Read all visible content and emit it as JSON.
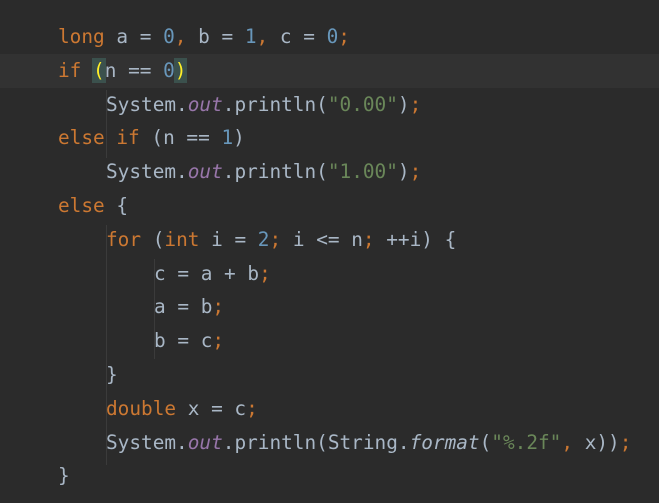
{
  "editor": {
    "colors": {
      "background": "#2b2b2b",
      "current_line": "#323232",
      "keyword": "#cc7832",
      "number": "#6897bb",
      "string": "#6a8759",
      "field": "#9876aa",
      "default": "#a9b7c6",
      "brace_match": "#ffef28"
    },
    "lines": [
      {
        "tokens": [
          {
            "t": "long",
            "c": "kw"
          },
          {
            "t": " a = ",
            "c": "plain"
          },
          {
            "t": "0",
            "c": "num"
          },
          {
            "t": ", ",
            "c": "punc"
          },
          {
            "t": "b = ",
            "c": "plain"
          },
          {
            "t": "1",
            "c": "num"
          },
          {
            "t": ", ",
            "c": "punc"
          },
          {
            "t": "c = ",
            "c": "plain"
          },
          {
            "t": "0",
            "c": "num"
          },
          {
            "t": ";",
            "c": "punc"
          }
        ]
      },
      {
        "current": true,
        "tokens": [
          {
            "t": "if",
            "c": "kw"
          },
          {
            "t": " ",
            "c": "plain"
          },
          {
            "t": "(",
            "c": "brace-match"
          },
          {
            "t": "n == ",
            "c": "plain"
          },
          {
            "t": "0",
            "c": "num"
          },
          {
            "t": ")",
            "c": "brace-match"
          }
        ]
      },
      {
        "indent": 1,
        "tokens": [
          {
            "t": "System.",
            "c": "plain"
          },
          {
            "t": "out",
            "c": "fld"
          },
          {
            "t": ".println(",
            "c": "plain"
          },
          {
            "t": "\"0.00\"",
            "c": "str"
          },
          {
            "t": ")",
            "c": "plain"
          },
          {
            "t": ";",
            "c": "punc"
          }
        ]
      },
      {
        "tokens": [
          {
            "t": "else if",
            "c": "kw"
          },
          {
            "t": " (n == ",
            "c": "plain"
          },
          {
            "t": "1",
            "c": "num"
          },
          {
            "t": ")",
            "c": "plain"
          }
        ]
      },
      {
        "indent": 1,
        "tokens": [
          {
            "t": "System.",
            "c": "plain"
          },
          {
            "t": "out",
            "c": "fld"
          },
          {
            "t": ".println(",
            "c": "plain"
          },
          {
            "t": "\"1.00\"",
            "c": "str"
          },
          {
            "t": ")",
            "c": "plain"
          },
          {
            "t": ";",
            "c": "punc"
          }
        ]
      },
      {
        "tokens": [
          {
            "t": "else",
            "c": "kw"
          },
          {
            "t": " {",
            "c": "plain"
          }
        ]
      },
      {
        "indent": 1,
        "tokens": [
          {
            "t": "for",
            "c": "kw"
          },
          {
            "t": " (",
            "c": "plain"
          },
          {
            "t": "int",
            "c": "kw"
          },
          {
            "t": " i = ",
            "c": "plain"
          },
          {
            "t": "2",
            "c": "num"
          },
          {
            "t": "; ",
            "c": "punc"
          },
          {
            "t": "i <= n",
            "c": "plain"
          },
          {
            "t": "; ",
            "c": "punc"
          },
          {
            "t": "++i) {",
            "c": "plain"
          }
        ]
      },
      {
        "indent": 2,
        "tokens": [
          {
            "t": "c = a + b",
            "c": "plain"
          },
          {
            "t": ";",
            "c": "punc"
          }
        ]
      },
      {
        "indent": 2,
        "tokens": [
          {
            "t": "a = b",
            "c": "plain"
          },
          {
            "t": ";",
            "c": "punc"
          }
        ]
      },
      {
        "indent": 2,
        "tokens": [
          {
            "t": "b = c",
            "c": "plain"
          },
          {
            "t": ";",
            "c": "punc"
          }
        ]
      },
      {
        "indent": 1,
        "tokens": [
          {
            "t": "}",
            "c": "plain"
          }
        ]
      },
      {
        "indent": 1,
        "tokens": [
          {
            "t": "double",
            "c": "kw"
          },
          {
            "t": " x = c",
            "c": "plain"
          },
          {
            "t": ";",
            "c": "punc"
          }
        ]
      },
      {
        "indent": 1,
        "tokens": [
          {
            "t": "System.",
            "c": "plain"
          },
          {
            "t": "out",
            "c": "fld"
          },
          {
            "t": ".println(String.",
            "c": "plain"
          },
          {
            "t": "format",
            "c": "ital"
          },
          {
            "t": "(",
            "c": "plain"
          },
          {
            "t": "\"%.2f\"",
            "c": "str"
          },
          {
            "t": ", ",
            "c": "punc"
          },
          {
            "t": "x))",
            "c": "plain"
          },
          {
            "t": ";",
            "c": "punc"
          }
        ]
      },
      {
        "tokens": [
          {
            "t": "}",
            "c": "plain"
          }
        ]
      }
    ]
  }
}
